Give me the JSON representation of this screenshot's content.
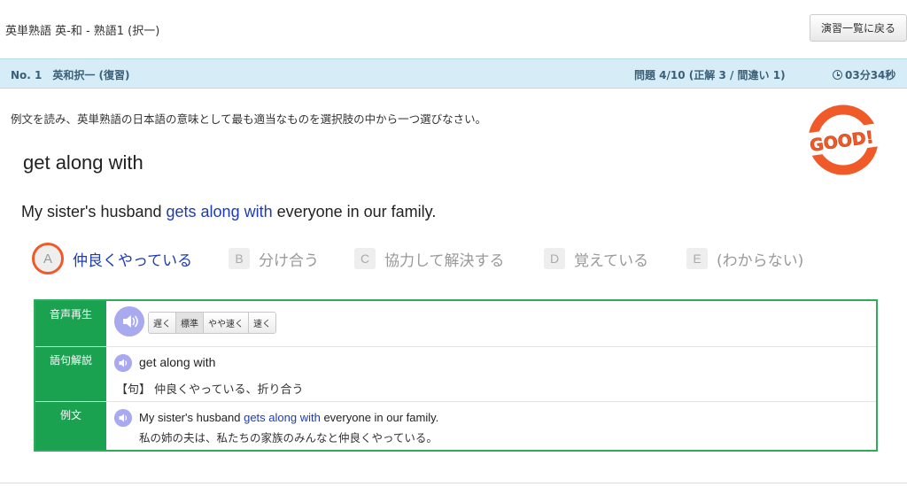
{
  "header": {
    "page_title": "英単熟語 英-和 - 熟語1 (択一)",
    "back_button": "演習一覧に戻る"
  },
  "status_bar": {
    "question_label": "No. 1　英和択一 (復習)",
    "progress": "問題 4/10 (正解 3 / 間違い 1)",
    "timer": "03分34秒",
    "timer_icon": "clock-icon"
  },
  "instruction": "例文を読み、英単熟語の日本語の意味として最も適当なものを選択肢の中から一つ選びなさい。",
  "stamp_text": "GOOD!",
  "question": {
    "term": "get along with",
    "sentence_before": "My sister's husband ",
    "sentence_highlight": "gets along with",
    "sentence_after": " everyone in our family."
  },
  "choices": [
    {
      "letter": "A",
      "text": "仲良くやっている",
      "selected": true
    },
    {
      "letter": "B",
      "text": "分け合う",
      "selected": false
    },
    {
      "letter": "C",
      "text": "協力して解決する",
      "selected": false
    },
    {
      "letter": "D",
      "text": "覚えている",
      "selected": false
    },
    {
      "letter": "E",
      "text": "(わからない)",
      "selected": false
    }
  ],
  "panel": {
    "audio_label": "音声再生",
    "speed_buttons": [
      "遅く",
      "標準",
      "やや速く",
      "速く"
    ],
    "active_speed": "標準",
    "explanation_label": "語句解説",
    "phrase": "get along with",
    "meaning": "【句】 仲良くやっている、折り合う",
    "example_label": "例文",
    "example_en_before": "My sister's husband ",
    "example_en_highlight": "gets along with",
    "example_en_after": " everyone in our family.",
    "example_ja": "私の姉の夫は、私たちの家族のみんなと仲良くやっている。"
  },
  "colors": {
    "accent_blue": "#1f3bb3",
    "panel_green": "#1aa251",
    "stamp_orange": "#f05a28",
    "speaker_purple": "#a9a9ef"
  }
}
